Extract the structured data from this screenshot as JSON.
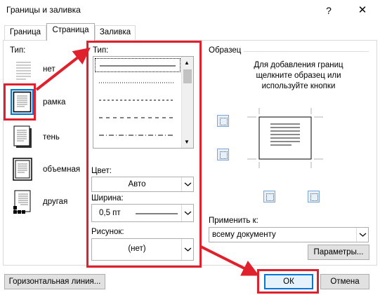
{
  "window": {
    "title": "Границы и заливка",
    "help_label": "?",
    "close_label": "✕"
  },
  "tabs": [
    {
      "label": "Граница",
      "active": false
    },
    {
      "label": "Страница",
      "active": true
    },
    {
      "label": "Заливка",
      "active": false
    }
  ],
  "left": {
    "type_label": "Тип:",
    "types": [
      {
        "label": "нет",
        "icon": "none-border-icon"
      },
      {
        "label": "рамка",
        "icon": "box-border-icon",
        "selected": true
      },
      {
        "label": "тень",
        "icon": "shadow-border-icon"
      },
      {
        "label": "объемная",
        "icon": "3d-border-icon"
      },
      {
        "label": "другая",
        "icon": "custom-border-icon"
      }
    ]
  },
  "middle": {
    "style_label": "Тип:",
    "styles": [
      "solid",
      "dotted",
      "dashed",
      "dash-large",
      "dash-dot"
    ],
    "color_label": "Цвет:",
    "color_value": "Авто",
    "width_label": "Ширина:",
    "width_value": "0,5 пт",
    "art_label": "Рисунок:",
    "art_value": "(нет)"
  },
  "preview": {
    "group_label": "Образец",
    "hint": "Для добавления границ щелкните образец или используйте кнопки",
    "apply_label": "Применить к:",
    "apply_value": "всему документу",
    "options_button": "Параметры..."
  },
  "footer": {
    "horizontal_line_button": "Горизонтальная линия...",
    "ok_button": "ОК",
    "cancel_button": "Отмена"
  },
  "colors": {
    "annotation_red": "#e0202c",
    "selection_blue": "#0078d7"
  }
}
